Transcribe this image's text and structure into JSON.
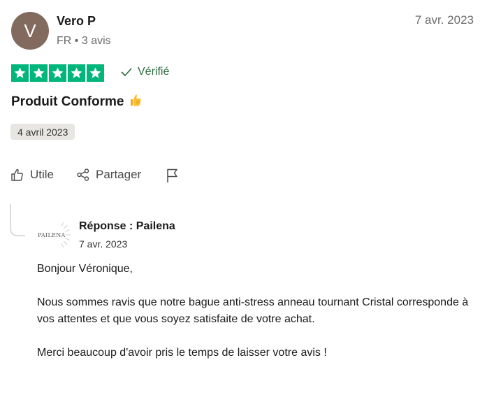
{
  "review": {
    "author": {
      "initial": "V",
      "name": "Vero P",
      "country": "FR",
      "reviews_count": "3 avis",
      "avatar_color": "#836a5e"
    },
    "date": "7 avr. 2023",
    "rating": {
      "value": 5,
      "max": 5,
      "color": "#00b67a"
    },
    "verified_label": "Vérifié",
    "title": "Produit Conforme",
    "title_emoji": "👍",
    "experience_date": "4 avril 2023"
  },
  "actions": {
    "useful_label": "Utile",
    "share_label": "Partager"
  },
  "reply": {
    "logo_text": "PAILENA",
    "title": "Réponse : Pailena",
    "date": "7 avr. 2023",
    "paragraphs": [
      "Bonjour Véronique,",
      "Nous sommes ravis que notre bague anti-stress anneau tournant Cristal corresponde à vos attentes et que vous soyez satisfaite de votre achat.",
      "Merci beaucoup d'avoir pris le temps de laisser votre avis !"
    ]
  }
}
